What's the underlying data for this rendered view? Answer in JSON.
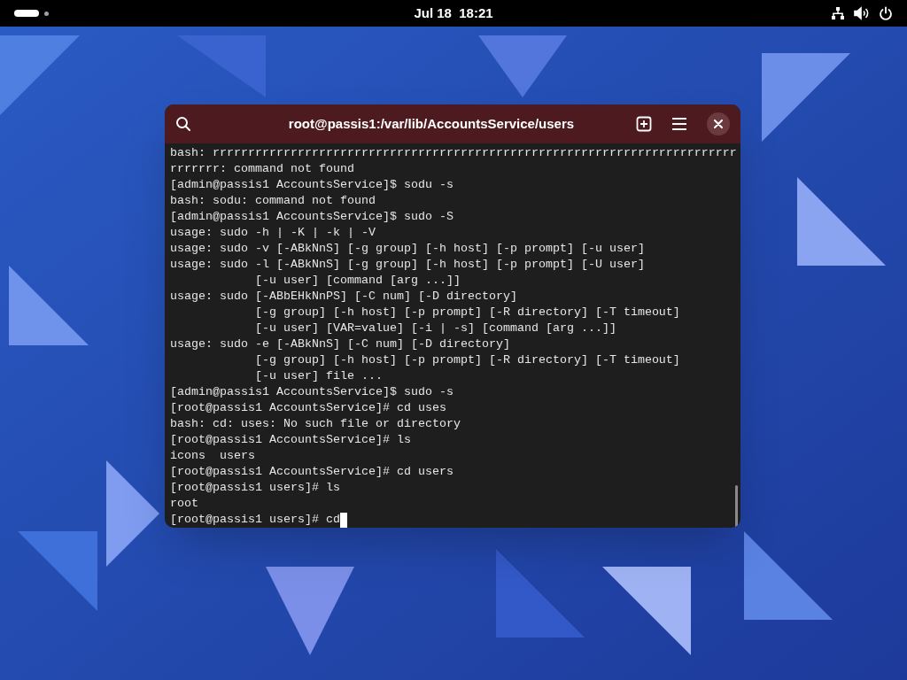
{
  "top_bar": {
    "clock": "Jul 18  18:21"
  },
  "terminal": {
    "title": "root@passis1:/var/lib/AccountsService/users",
    "lines": [
      "bash: rrrrrrrrrrrrrrrrrrrrrrrrrrrrrrrrrrrrrrrrrrrrrrrrrrrrrrrrrrrrrrrrrrrrrrrrrr",
      "rrrrrrr: command not found",
      "[admin@passis1 AccountsService]$ sodu -s",
      "bash: sodu: command not found",
      "[admin@passis1 AccountsService]$ sudo -S",
      "usage: sudo -h | -K | -k | -V",
      "usage: sudo -v [-ABkNnS] [-g group] [-h host] [-p prompt] [-u user]",
      "usage: sudo -l [-ABkNnS] [-g group] [-h host] [-p prompt] [-U user]",
      "            [-u user] [command [arg ...]]",
      "usage: sudo [-ABbEHkNnPS] [-C num] [-D directory]",
      "            [-g group] [-h host] [-p prompt] [-R directory] [-T timeout]",
      "            [-u user] [VAR=value] [-i | -s] [command [arg ...]]",
      "usage: sudo -e [-ABkNnS] [-C num] [-D directory]",
      "            [-g group] [-h host] [-p prompt] [-R directory] [-T timeout]",
      "            [-u user] file ...",
      "[admin@passis1 AccountsService]$ sudo -s",
      "[root@passis1 AccountsService]# cd uses",
      "bash: cd: uses: No such file or directory",
      "[root@passis1 AccountsService]# ls",
      "icons  users",
      "[root@passis1 AccountsService]# cd users",
      "[root@passis1 users]# ls",
      "root",
      "[root@passis1 users]# cd"
    ]
  }
}
